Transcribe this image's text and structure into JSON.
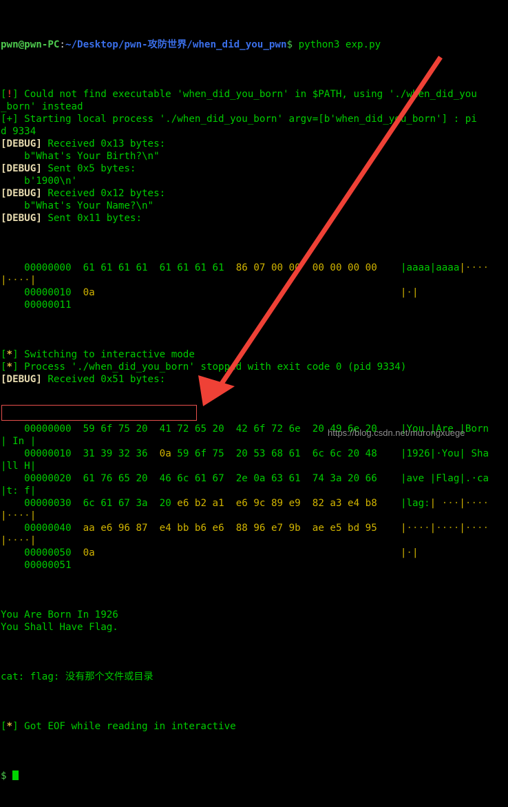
{
  "terminal": {
    "prompt": {
      "user": "pwn@pwn-PC",
      "colon": ":",
      "path": "~/Desktop/pwn-攻防世界/when_did_you_pwn",
      "dollar": "$",
      "command": " python3 exp.py"
    },
    "lines": [
      {
        "type": "tag-warn",
        "tag_open": "[",
        "tag_sym": "!",
        "tag_close": "]",
        "text": " Could not find executable 'when_did_you_born' in $PATH, using './when_did_you"
      },
      {
        "type": "plain",
        "text": "_born' instead"
      },
      {
        "type": "tag-plus",
        "tag_open": "[",
        "tag_sym": "+",
        "tag_close": "]",
        "text": " Starting local process './when_did_you_born' argv=[b'when_did_you_born'] : pi"
      },
      {
        "type": "plain",
        "text": "d 9334"
      },
      {
        "type": "tag-debug",
        "tag_open": "[",
        "tag_sym": "DEBUG",
        "tag_close": "]",
        "text": " Received 0x13 bytes:"
      },
      {
        "type": "plain",
        "text": "    b\"What's Your Birth?\\n\""
      },
      {
        "type": "tag-debug",
        "tag_open": "[",
        "tag_sym": "DEBUG",
        "tag_close": "]",
        "text": " Sent 0x5 bytes:"
      },
      {
        "type": "plain",
        "text": "    b'1900\\n'"
      },
      {
        "type": "tag-debug",
        "tag_open": "[",
        "tag_sym": "DEBUG",
        "tag_close": "]",
        "text": " Received 0x12 bytes:"
      },
      {
        "type": "plain",
        "text": "    b\"What's Your Name?\\n\""
      },
      {
        "type": "tag-debug",
        "tag_open": "[",
        "tag_sym": "DEBUG",
        "tag_close": "]",
        "text": " Sent 0x11 bytes:"
      }
    ],
    "hexdump1": {
      "rows": [
        {
          "offset": "00000000",
          "groups": [
            {
              "bytes": [
                "61",
                "61",
                "61",
                "61"
              ],
              "kind": "green"
            },
            {
              "bytes": [
                "61",
                "61",
                "61",
                "61"
              ],
              "kind": "green"
            },
            {
              "bytes": [
                "86",
                "07",
                "00",
                "00"
              ],
              "kind": "yellow"
            },
            {
              "bytes": [
                "00",
                "00",
                "00",
                "00"
              ],
              "kind": "yellow"
            }
          ],
          "ascii_groups": [
            {
              "text": "aaaa",
              "kind": "green"
            },
            {
              "text": "aaaa",
              "kind": "green"
            },
            {
              "text": "····",
              "kind": "yellow"
            },
            {
              "text": "····",
              "kind": "yellow"
            }
          ],
          "wrapped": true
        },
        {
          "offset": "00000010",
          "groups": [
            {
              "bytes": [
                "0a"
              ],
              "kind": "yellow"
            }
          ],
          "ascii_groups": [
            {
              "text": "·",
              "kind": "yellow"
            }
          ],
          "wrapped": false
        }
      ],
      "final_offset": "00000011"
    },
    "mid_lines": [
      {
        "type": "tag-star",
        "tag_open": "[",
        "tag_sym": "*",
        "tag_close": "]",
        "text": " Switching to interactive mode"
      },
      {
        "type": "tag-star",
        "tag_open": "[",
        "tag_sym": "*",
        "tag_close": "]",
        "text": " Process './when_did_you_born' stopped with exit code 0 (pid 9334)"
      },
      {
        "type": "tag-debug",
        "tag_open": "[",
        "tag_sym": "DEBUG",
        "tag_close": "]",
        "text": " Received 0x51 bytes:"
      }
    ],
    "hexdump2": {
      "rows": [
        {
          "offset": "00000000",
          "groups": [
            {
              "bytes": [
                "59",
                "6f",
                "75",
                "20"
              ],
              "kind": "green"
            },
            {
              "bytes": [
                "41",
                "72",
                "65",
                "20"
              ],
              "kind": "green"
            },
            {
              "bytes": [
                "42",
                "6f",
                "72",
                "6e"
              ],
              "kind": "green"
            },
            {
              "bytes": [
                "20",
                "49",
                "6e",
                "20"
              ],
              "kind": "green"
            }
          ],
          "ascii_groups": [
            {
              "text": "You ",
              "kind": "green"
            },
            {
              "text": "Are ",
              "kind": "green"
            },
            {
              "text": "Born",
              "kind": "green"
            },
            {
              "text": " In ",
              "kind": "green"
            }
          ],
          "wrapped": true
        },
        {
          "offset": "00000010",
          "groups": [
            {
              "bytes": [
                "31",
                "39",
                "32",
                "36"
              ],
              "kind": "green"
            },
            {
              "bytes": [
                "0a",
                "59",
                "6f",
                "75"
              ],
              "kind": "mixed-0a"
            },
            {
              "bytes": [
                "20",
                "53",
                "68",
                "61"
              ],
              "kind": "green"
            },
            {
              "bytes": [
                "6c",
                "6c",
                "20",
                "48"
              ],
              "kind": "green"
            }
          ],
          "ascii_groups": [
            {
              "text": "1926",
              "kind": "green"
            },
            {
              "text": "·You",
              "kind": "green"
            },
            {
              "text": " Sha",
              "kind": "green"
            },
            {
              "text": "ll H",
              "kind": "green"
            }
          ],
          "wrapped": true
        },
        {
          "offset": "00000020",
          "groups": [
            {
              "bytes": [
                "61",
                "76",
                "65",
                "20"
              ],
              "kind": "green"
            },
            {
              "bytes": [
                "46",
                "6c",
                "61",
                "67"
              ],
              "kind": "green"
            },
            {
              "bytes": [
                "2e",
                "0a",
                "63",
                "61"
              ],
              "kind": "green"
            },
            {
              "bytes": [
                "74",
                "3a",
                "20",
                "66"
              ],
              "kind": "green"
            }
          ],
          "ascii_groups": [
            {
              "text": "ave ",
              "kind": "green"
            },
            {
              "text": "Flag",
              "kind": "green"
            },
            {
              "text": ".·ca",
              "kind": "green"
            },
            {
              "text": "t: f",
              "kind": "green"
            }
          ],
          "wrapped": true
        },
        {
          "offset": "00000030",
          "groups": [
            {
              "bytes": [
                "6c",
                "61",
                "67",
                "3a"
              ],
              "kind": "green"
            },
            {
              "bytes": [
                "20",
                "e6",
                "b2",
                "a1"
              ],
              "kind": "mixed-first"
            },
            {
              "bytes": [
                "e6",
                "9c",
                "89",
                "e9"
              ],
              "kind": "yellow"
            },
            {
              "bytes": [
                "82",
                "a3",
                "e4",
                "b8"
              ],
              "kind": "yellow"
            }
          ],
          "ascii_groups": [
            {
              "text": "lag:",
              "kind": "green"
            },
            {
              "text": " ···",
              "kind": "yellow"
            },
            {
              "text": "····",
              "kind": "yellow"
            },
            {
              "text": "····",
              "kind": "yellow"
            }
          ],
          "wrapped": true
        },
        {
          "offset": "00000040",
          "groups": [
            {
              "bytes": [
                "aa",
                "e6",
                "96",
                "87"
              ],
              "kind": "yellow"
            },
            {
              "bytes": [
                "e4",
                "bb",
                "b6",
                "e6"
              ],
              "kind": "yellow"
            },
            {
              "bytes": [
                "88",
                "96",
                "e7",
                "9b"
              ],
              "kind": "yellow"
            },
            {
              "bytes": [
                "ae",
                "e5",
                "bd",
                "95"
              ],
              "kind": "yellow"
            }
          ],
          "ascii_groups": [
            {
              "text": "····",
              "kind": "yellow"
            },
            {
              "text": "····",
              "kind": "yellow"
            },
            {
              "text": "····",
              "kind": "yellow"
            },
            {
              "text": "····",
              "kind": "yellow"
            }
          ],
          "wrapped": true
        },
        {
          "offset": "00000050",
          "groups": [
            {
              "bytes": [
                "0a"
              ],
              "kind": "yellow"
            }
          ],
          "ascii_groups": [
            {
              "text": "·",
              "kind": "yellow"
            }
          ],
          "wrapped": false
        }
      ],
      "final_offset": "00000051"
    },
    "output_lines": [
      {
        "text": "You Are Born In 1926"
      },
      {
        "text": "You Shall Have Flag."
      }
    ],
    "highlighted_line": "cat: flag: 没有那个文件或目录",
    "eof_line": {
      "tag_open": "[",
      "tag_sym": "*",
      "tag_close": "]",
      "text": " Got EOF while reading in interactive"
    },
    "final_prompt": "$"
  },
  "annotations": {
    "arrow_color": "#ef4136",
    "box_color": "#e8504c"
  },
  "watermark": "https://blog.csdn.net/murongxuege"
}
